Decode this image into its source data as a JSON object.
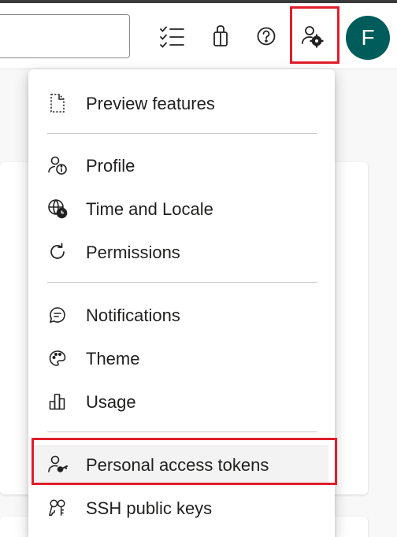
{
  "header": {
    "search_value": "",
    "avatar_initial": "F",
    "icons": [
      "work-items-icon",
      "marketplace-bag-icon",
      "help-icon",
      "user-settings-icon"
    ]
  },
  "colors": {
    "highlight": "#e01e2b",
    "avatar_bg": "#005b5b",
    "active_item_bg": "#f3f3f3"
  },
  "user_settings_menu": {
    "items": [
      {
        "label": "Preview features",
        "icon": "page-icon"
      },
      {
        "label": "Profile",
        "icon": "person-info-icon"
      },
      {
        "label": "Time and Locale",
        "icon": "globe-clock-icon"
      },
      {
        "label": "Permissions",
        "icon": "refresh-icon"
      },
      {
        "label": "Notifications",
        "icon": "chat-bubble-icon"
      },
      {
        "label": "Theme",
        "icon": "palette-icon"
      },
      {
        "label": "Usage",
        "icon": "bar-chart-icon"
      },
      {
        "label": "Personal access tokens",
        "icon": "person-key-icon",
        "highlighted": true
      },
      {
        "label": "SSH public keys",
        "icon": "keys-icon"
      }
    ]
  }
}
